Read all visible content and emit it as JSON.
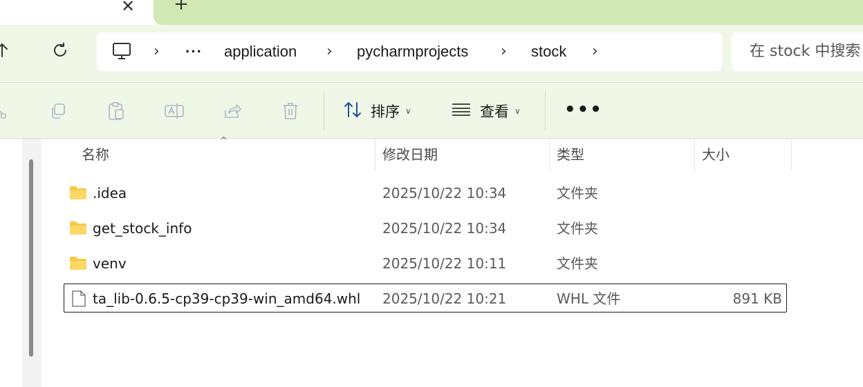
{
  "titlebar": {
    "close_glyph": "✕",
    "new_tab_glyph": "+"
  },
  "address": {
    "computer_icon": "computer-icon",
    "more_glyph": "···",
    "crumbs": [
      "application",
      "pycharmprojects",
      "stock"
    ]
  },
  "search": {
    "placeholder": "在 stock 中搜索"
  },
  "toolbar": {
    "sort_label": "排序",
    "view_label": "查看",
    "more_glyph": "•••"
  },
  "columns": {
    "name": "名称",
    "modified": "修改日期",
    "type": "类型",
    "size": "大小"
  },
  "files": [
    {
      "name": ".idea",
      "modified": "2025/10/22 10:34",
      "type": "文件夹",
      "size": "",
      "kind": "folder"
    },
    {
      "name": "get_stock_info",
      "modified": "2025/10/22 10:34",
      "type": "文件夹",
      "size": "",
      "kind": "folder"
    },
    {
      "name": "venv",
      "modified": "2025/10/22 10:11",
      "type": "文件夹",
      "size": "",
      "kind": "folder"
    },
    {
      "name": "ta_lib-0.6.5-cp39-cp39-win_amd64.whl",
      "modified": "2025/10/22 10:21",
      "type": "WHL 文件",
      "size": "891 KB",
      "kind": "file"
    }
  ],
  "colors": {
    "accent_green": "#d2e8b4",
    "pane_green": "#f0f7e6",
    "folder_yellow": "#f7c948"
  }
}
